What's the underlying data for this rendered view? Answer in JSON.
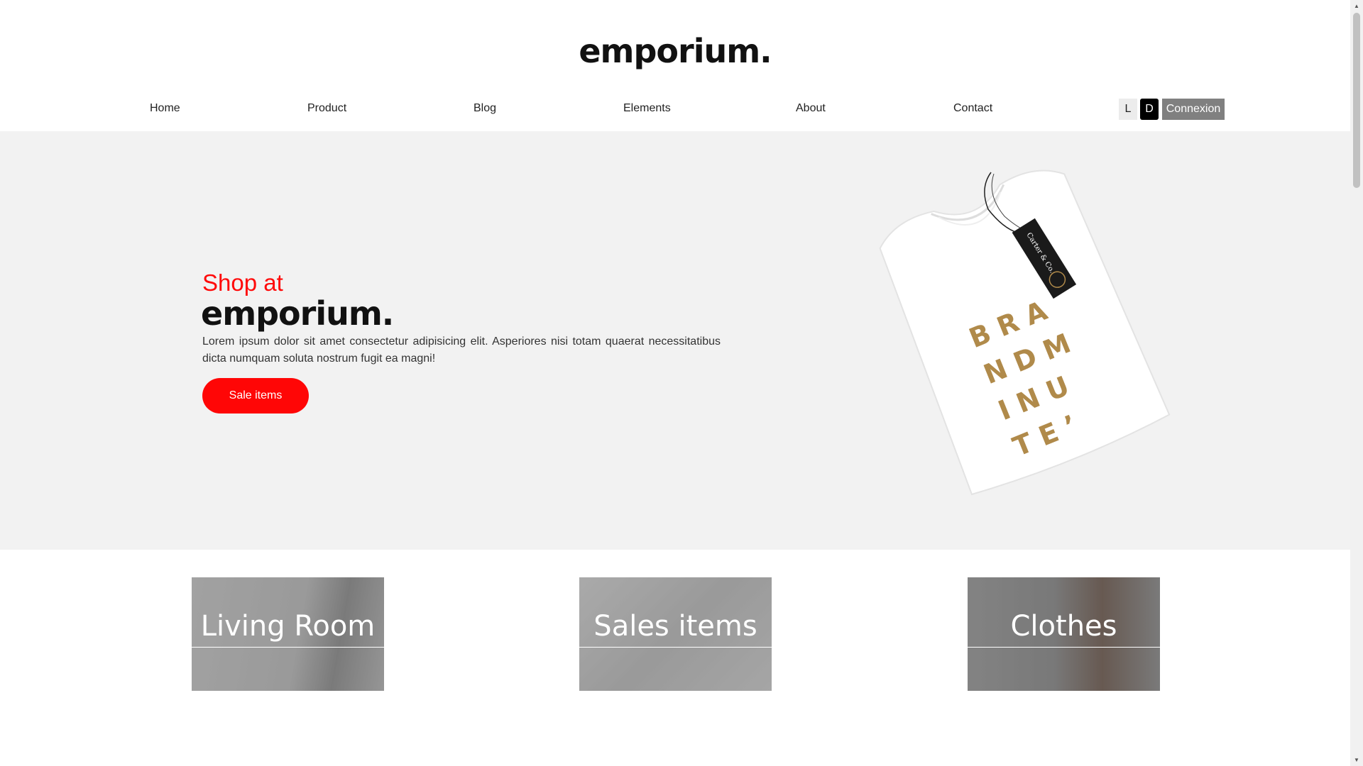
{
  "header": {
    "logo": "emporium.",
    "nav": [
      "Home",
      "Product",
      "Blog",
      "Elements",
      "About",
      "Contact"
    ],
    "theme_light": "L",
    "theme_dark": "D",
    "login_label": "Connexion"
  },
  "hero": {
    "subtitle": "Shop at",
    "title": "emporium.",
    "text": "Lorem ipsum dolor sit amet consectetur adipisicing elit. Asperiores nisi totam quaerat necessitatibus dicta numquam soluta nostrum fugit ea magni!",
    "cta_label": "Sale items",
    "tag_text": "Carter & Co.",
    "shirt_print": [
      "B R A",
      "N D   M",
      "I  N U",
      "T  E ’"
    ]
  },
  "categories": [
    {
      "label": "Living Room"
    },
    {
      "label": "Sales items"
    },
    {
      "label": "Clothes"
    }
  ],
  "colors": {
    "accent": "#ff0a0a",
    "hero_bg": "#f2f2f2",
    "login_bg": "#808080"
  }
}
